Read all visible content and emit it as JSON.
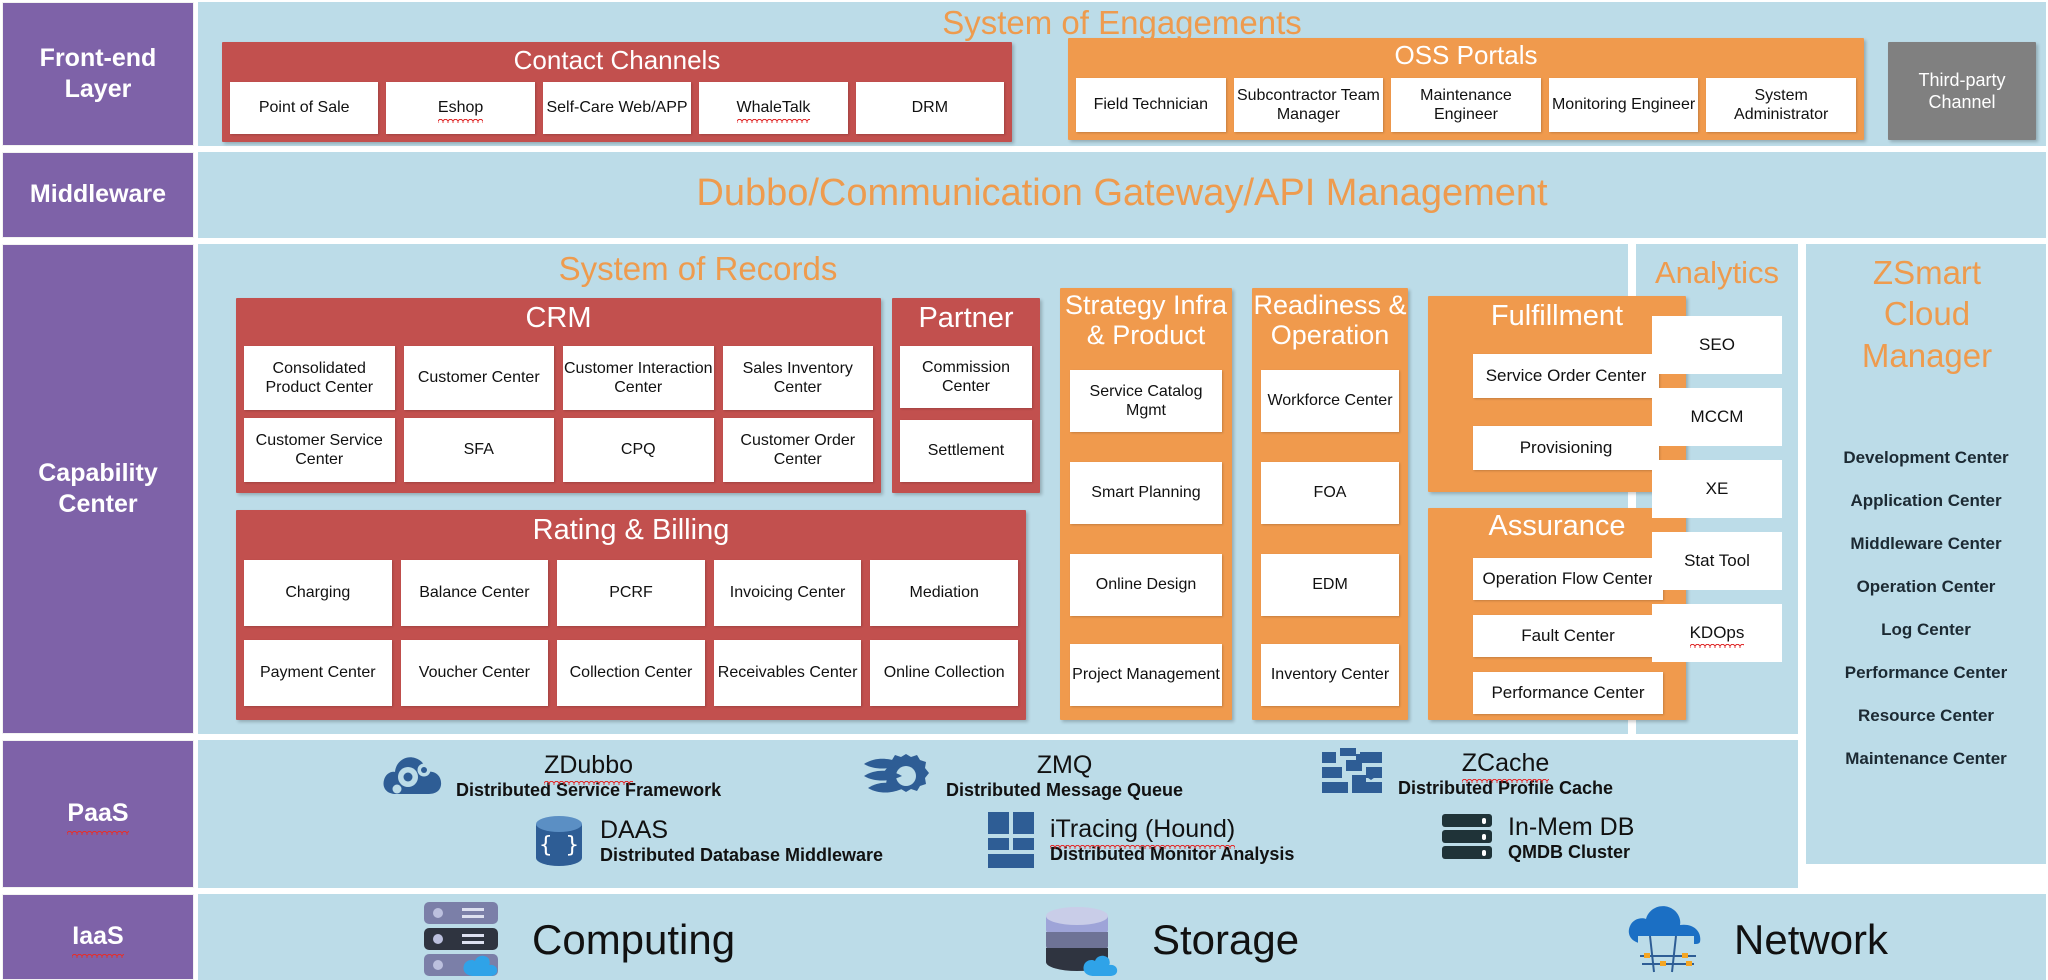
{
  "colors": {
    "purple": "#7E62A8",
    "lightblue": "#BCDCE8",
    "red": "#C2504E",
    "orange": "#F09A4D",
    "orange_text": "#EE9B4E",
    "gray": "#808080",
    "white": "#FFFFFF"
  },
  "sidebar": {
    "items": [
      {
        "label": "Front-end Layer",
        "line1": "Front-end",
        "line2": "Layer"
      },
      {
        "label": "Middleware",
        "line1": "Middleware",
        "line2": ""
      },
      {
        "label": "Capability Center",
        "line1": "Capability",
        "line2": "Center"
      },
      {
        "label": "PaaS",
        "line1": "PaaS",
        "line2": ""
      },
      {
        "label": "IaaS",
        "line1": "IaaS",
        "line2": ""
      }
    ]
  },
  "front_end": {
    "section_title": "System of Engagements",
    "contact_channels": {
      "title": "Contact Channels",
      "items": [
        "Point of Sale",
        "Eshop",
        "Self-Care Web/APP",
        "WhaleTalk",
        "DRM"
      ]
    },
    "oss_portals": {
      "title": "OSS Portals",
      "items": [
        "Field Technician",
        "Subcontractor Team Manager",
        "Maintenance Engineer",
        "Monitoring Engineer",
        "System Administrator"
      ]
    },
    "third_party": {
      "title": "Third-party Channel"
    }
  },
  "middleware": {
    "title": "Dubbo/Communication Gateway/API Management"
  },
  "capability": {
    "section_title": "System of Records",
    "crm": {
      "title": "CRM",
      "row1": [
        "Consolidated Product Center",
        "Customer Center",
        "Customer Interaction Center",
        "Sales Inventory Center"
      ],
      "row2": [
        "Customer Service Center",
        "SFA",
        "CPQ",
        "Customer Order Center"
      ]
    },
    "rating_billing": {
      "title": "Rating & Billing",
      "row1": [
        "Charging",
        "Balance Center",
        "PCRF",
        "Invoicing Center",
        "Mediation"
      ],
      "row2": [
        "Payment Center",
        "Voucher Center",
        "Collection Center",
        "Receivables Center",
        "Online Collection"
      ]
    },
    "partner": {
      "title": "Partner",
      "items": [
        "Commission Center",
        "Settlement"
      ]
    },
    "strategy": {
      "title": "Strategy  Infra & Product",
      "title_line1": "Strategy  Infra",
      "title_line2": "& Product",
      "items": [
        "Service Catalog Mgmt",
        "Smart Planning",
        "Online Design",
        "Project Management"
      ]
    },
    "readiness": {
      "title": "Readiness & Operation",
      "title_line1": "Readiness &",
      "title_line2": "Operation",
      "items": [
        "Workforce Center",
        "FOA",
        "EDM",
        "Inventory Center"
      ]
    },
    "fulfillment": {
      "title": "Fulfillment",
      "items": [
        "Service Order Center",
        "Provisioning"
      ]
    },
    "assurance": {
      "title": "Assurance",
      "items": [
        "Operation Flow Center",
        "Fault Center",
        "Performance Center"
      ]
    },
    "analytics": {
      "title": "Analytics",
      "items": [
        "SEO",
        "MCCM",
        "XE",
        "Stat Tool",
        "KDOps"
      ]
    },
    "zsmart_cloud_manager": {
      "title": "ZSmart Cloud Manager",
      "title_line1": "ZSmart",
      "title_line2": "Cloud",
      "title_line3": "Manager",
      "items": [
        "Development Center",
        "Application Center",
        "Middleware Center",
        "Operation Center",
        "Log Center",
        "Performance Center",
        "Resource Center",
        "Maintenance Center"
      ]
    }
  },
  "paas": {
    "items": [
      {
        "name": "ZDubbo",
        "sub": "Distributed Service Framework",
        "icon": "cloud-gear-icon"
      },
      {
        "name": "ZMQ",
        "sub": "Distributed Message Queue",
        "icon": "queue-gear-icon"
      },
      {
        "name": "ZCache",
        "sub": "Distributed Profile Cache",
        "icon": "brick-cache-icon"
      },
      {
        "name": "DAAS",
        "sub": "Distributed Database  Middleware",
        "icon": "database-braces-icon"
      },
      {
        "name": "iTracing (Hound)",
        "sub": "Distributed Monitor Analysis",
        "icon": "grid-monitor-icon"
      },
      {
        "name": "In-Mem DB",
        "sub": "QMDB Cluster",
        "icon": "server-rack-icon"
      }
    ]
  },
  "iaas": {
    "items": [
      {
        "name": "Computing",
        "icon": "server-cloud-icon"
      },
      {
        "name": "Storage",
        "icon": "storage-cloud-icon"
      },
      {
        "name": "Network",
        "icon": "network-cloud-icon"
      }
    ]
  }
}
